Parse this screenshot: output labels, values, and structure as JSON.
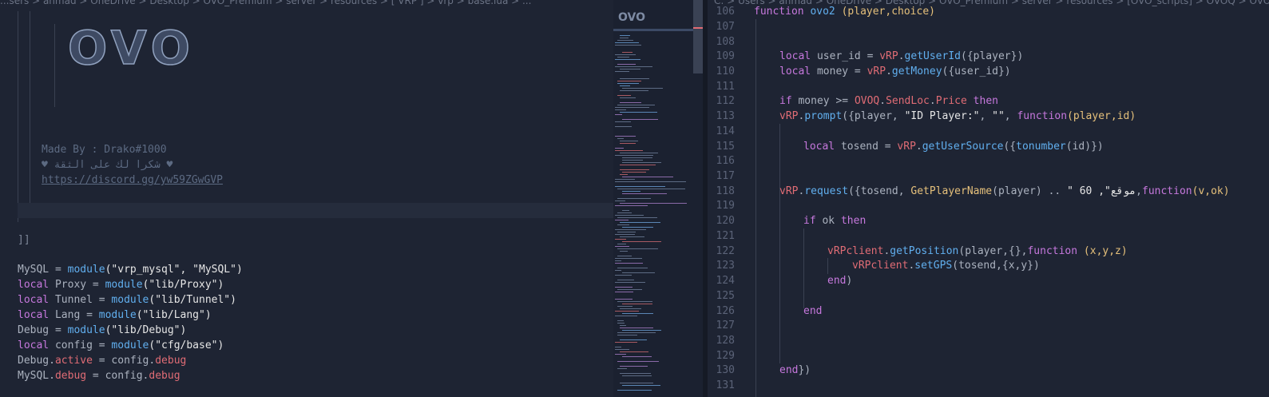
{
  "left_editor": {
    "breadcrumb": "...sers > ahmad > OneDrive > Desktop > OVO_Premium > server > resources > [ VRP ] > vrp > base.lua > ...",
    "banner": "OVO",
    "comments": [
      "Made By : Drako#1000",
      "♥ شكرا لك على الثقة ♥",
      "https://discord.gg/yw59ZGwGVP"
    ],
    "close_bracket": "]]",
    "code": [
      {
        "a": "MySQL",
        "b": " = ",
        "c": "module",
        "d": "(\"vrp_mysql\", \"MySQL\")"
      },
      {
        "k": "local",
        "a": " Proxy",
        "b": " = ",
        "c": "module",
        "d": "(\"lib/Proxy\")"
      },
      {
        "k": "local",
        "a": " Tunnel",
        "b": " = ",
        "c": "module",
        "d": "(\"lib/Tunnel\")"
      },
      {
        "k": "local",
        "a": " Lang",
        "b": " = ",
        "c": "module",
        "d": "(\"lib/Lang\")"
      },
      {
        "a": "Debug",
        "b": " = ",
        "c": "module",
        "d": "(\"lib/Debug\")"
      },
      {
        "k": "local",
        "a": " config",
        "b": " = ",
        "c": "module",
        "d": "(\"cfg/base\")"
      }
    ],
    "debug_lines": [
      {
        "obj": "Debug",
        "dot": ".",
        "prop": "active",
        "eq": " = config.",
        "val": "debug"
      },
      {
        "obj": "MySQL",
        "dot": ".",
        "prop": "debug",
        "eq": " = config.",
        "val": "debug"
      }
    ]
  },
  "minimap": {
    "title": "OVO"
  },
  "right_editor": {
    "breadcrumb": "C: > Users > ahmad > OneDrive > Desktop > OVO_Premium > server > resources > [OVO_scripts] > OVOQ > OVO_Co...",
    "line_numbers": [
      "106",
      "107",
      "108",
      "109",
      "110",
      "111",
      "112",
      "113",
      "114",
      "115",
      "116",
      "117",
      "118",
      "119",
      "120",
      "121",
      "122",
      "123",
      "124",
      "125",
      "126",
      "127",
      "128",
      "129",
      "130",
      "131"
    ],
    "lines": {
      "l106": {
        "kw": "function",
        "name": " ovo2",
        "args": " (player,choice)"
      },
      "l109": {
        "kw": "local",
        "a": " user_id = ",
        "obj": "vRP",
        "dot": ".",
        "fn": "getUserId",
        "rest": "({player})"
      },
      "l110": {
        "kw": "local",
        "a": " money = ",
        "obj": "vRP",
        "dot": ".",
        "fn": "getMoney",
        "rest": "({user_id})"
      },
      "l112": {
        "kw": "if",
        "a": " money >= ",
        "obj": "OVOQ",
        "dot": ".",
        "p1": "SendLoc",
        "dot2": ".",
        "p2": "Price",
        "kw2": " then"
      },
      "l113": {
        "obj": "vRP",
        "dot": ".",
        "fn": "prompt",
        "a": "({player, ",
        "s1": "\"ID Player:\"",
        "b": ", ",
        "s2": "\"\"",
        "c": ", ",
        "kw": "function",
        "d": "(player,id)"
      },
      "l115": {
        "kw": "local",
        "a": " tosend = ",
        "obj": "vRP",
        "dot": ".",
        "fn": "getUserSource",
        "b": "({",
        "fn2": "tonumber",
        "c": "(id)})"
      },
      "l118": {
        "obj": "vRP",
        "dot": ".",
        "fn": "request",
        "a": "({tosend, ",
        "fn2": "GetPlayerName",
        "b": "(player) .. ",
        "s1": "\" 60 ,\"موقع",
        "c": ",",
        "kw": "function",
        "d": "(v,ok)"
      },
      "l120": {
        "kw": "if",
        "a": " ok ",
        "kw2": "then"
      },
      "l122": {
        "obj": "vRPclient",
        "dot": ".",
        "fn": "getPosition",
        "a": "(player,{},",
        "kw": "function",
        "b": " (x,y,z)"
      },
      "l123": {
        "obj": "vRPclient",
        "dot": ".",
        "fn": "setGPS",
        "a": "(tosend,{x,y})"
      },
      "l124": {
        "kw": "end",
        "a": ")"
      },
      "l126": {
        "kw": "end"
      },
      "l130": {
        "kw": "end",
        "a": "})"
      }
    }
  },
  "colors": {
    "background": "#1e2433",
    "keyword": "#c678dd",
    "function": "#61afef",
    "property": "#e06c75",
    "parameter": "#e5c07b",
    "string": "#e6e6e6",
    "comment": "#5c6a82"
  }
}
